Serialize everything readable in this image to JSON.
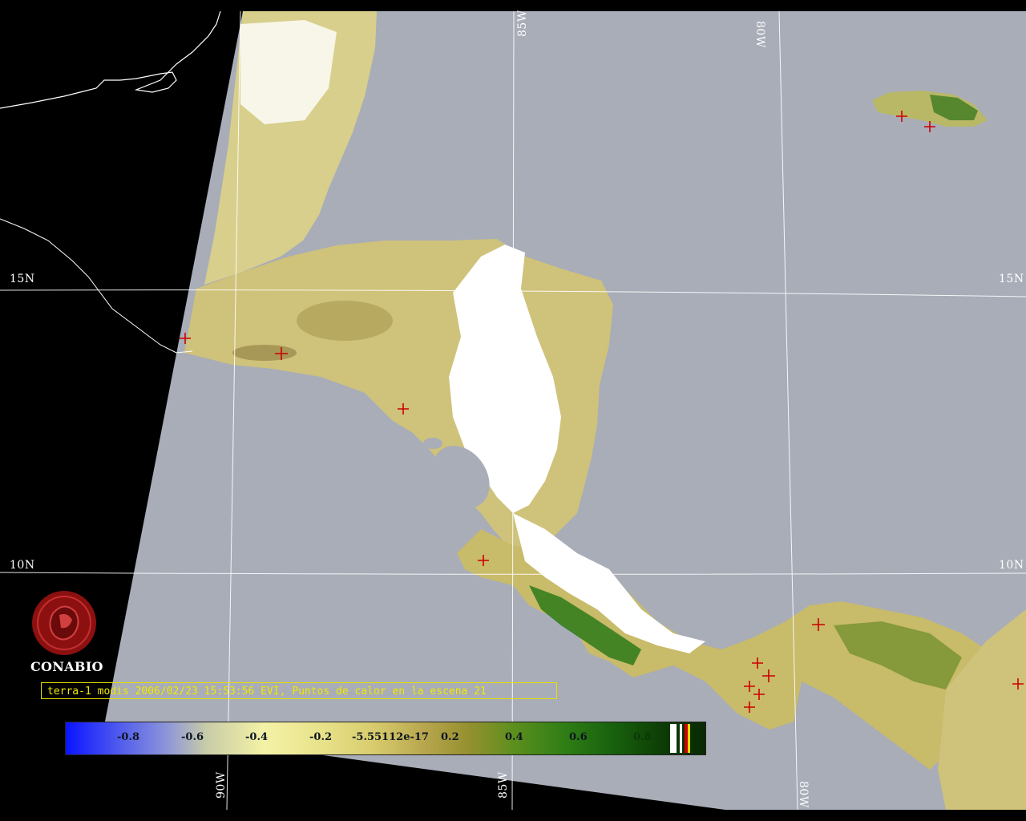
{
  "map": {
    "lat_labels": [
      "15N",
      "15N",
      "10N",
      "10N"
    ],
    "lon_labels": [
      "85W",
      "80W",
      "90W",
      "85W",
      "80W"
    ],
    "caption": "terra-1 modis 2006/02/23 15:53:56 EVI, Puntos de calor en la escena 21",
    "colorbar_ticks": [
      "-0.8",
      "-0.6",
      "-0.4",
      "-0.2",
      "-5.55112e-17",
      "0.2",
      "0.4",
      "0.6",
      "0.8"
    ],
    "logo_text": "CONABIO",
    "colors": {
      "background": "#000000",
      "ocean": "#a9adb8",
      "vegetation_low": "#d9cf8a",
      "vegetation_high": "#2f7e15",
      "cloud": "#ffffff",
      "hotspot": "#cc0000",
      "caption": "#f0e800"
    }
  }
}
